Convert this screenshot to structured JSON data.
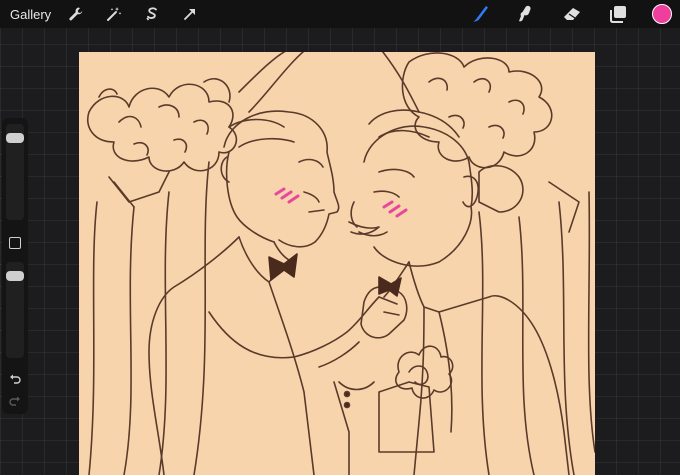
{
  "toolbar": {
    "gallery_label": "Gallery",
    "left_icons": [
      "wrench-icon",
      "magic-wand-icon",
      "selection-icon",
      "transform-arrow-icon"
    ],
    "right_icons": [
      "brush-icon",
      "smudge-icon",
      "eraser-icon",
      "layers-icon"
    ],
    "active_color": "#ee3f9c",
    "active_tool_color": "#2f7cf6"
  },
  "sidebar": {
    "brush_size_level": 0.9,
    "opacity_level": 0.9,
    "icons": [
      "modify-square-icon",
      "undo-icon",
      "redo-icon"
    ]
  },
  "canvas": {
    "background_color": "#f8d4ad",
    "line_color": "#5a3a2a",
    "blush_color": "#e8489b"
  }
}
